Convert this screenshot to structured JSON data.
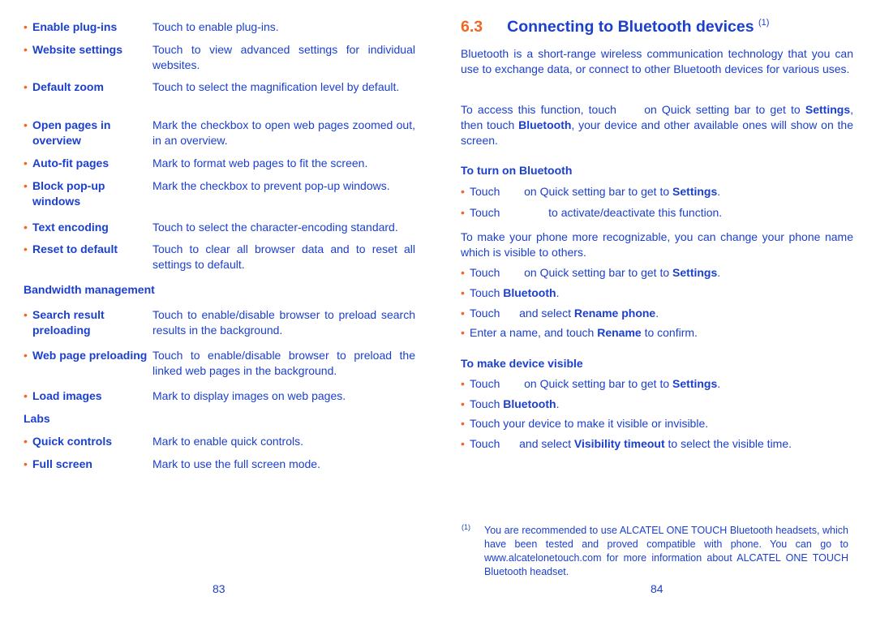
{
  "left": {
    "items": [
      {
        "label": "Enable plug-ins",
        "desc": "Touch to enable plug-ins."
      },
      {
        "label": "Website settings",
        "desc": "Touch to view advanced settings for individual websites."
      },
      {
        "label": "Default zoom",
        "desc": "Touch to select the magnification level by default."
      },
      {
        "label": "Open pages in overview",
        "desc": "Mark the checkbox to open web pages zoomed out, in an overview."
      },
      {
        "label": "Auto-fit pages",
        "desc": "Mark to format web pages to fit the screen."
      },
      {
        "label": "Block pop-up windows",
        "desc": "Mark the checkbox to prevent pop-up windows."
      },
      {
        "label": "Text encoding",
        "desc": "Touch to select the character-encoding standard."
      },
      {
        "label": "Reset to default",
        "desc": "Touch to clear all browser data and to reset all settings to default."
      },
      {
        "label": "Search result preloading",
        "desc": "Touch to enable/disable browser to preload search results in the background."
      },
      {
        "label": "Web page preloading",
        "desc": "Touch to enable/disable browser to preload the linked web pages in the background."
      },
      {
        "label": "Load images",
        "desc": "Mark to display images on web pages."
      },
      {
        "label": "Quick controls",
        "desc": "Mark to enable quick controls."
      },
      {
        "label": "Full screen",
        "desc": "Mark to use the full screen mode."
      }
    ],
    "headings": [
      "Bandwidth management",
      "Labs"
    ],
    "page_number": "83"
  },
  "right": {
    "section_number": "6.3",
    "title": "Connecting to Bluetooth devices",
    "title_note": "(1)",
    "blocks": [
      {
        "type": "para",
        "parts": [
          {
            "t": "Bluetooth is a short-range wireless communication technology that you can use to exchange data, or connect to other Bluetooth devices for various uses."
          }
        ]
      },
      {
        "type": "para",
        "parts": [
          {
            "t": "To access this function, touch "
          },
          {
            "gap": 1
          },
          {
            "t": " on Quick setting bar to get to "
          },
          {
            "t": "Settings",
            "b": true
          },
          {
            "t": ", then touch "
          },
          {
            "t": "Bluetooth",
            "b": true
          },
          {
            "t": ", your device and other available ones will show on the screen."
          }
        ]
      },
      {
        "type": "sub",
        "parts": [
          {
            "t": "To turn on Bluetooth"
          }
        ]
      },
      {
        "type": "bullet",
        "parts": [
          {
            "t": "Touch "
          },
          {
            "gap": 1
          },
          {
            "t": " on Quick setting bar to get to "
          },
          {
            "t": "Settings",
            "b": true
          },
          {
            "t": "."
          }
        ]
      },
      {
        "type": "bullet",
        "parts": [
          {
            "t": "Touch "
          },
          {
            "gap": 2
          },
          {
            "t": " to activate/deactivate this function."
          }
        ]
      },
      {
        "type": "para",
        "parts": [
          {
            "t": "To make your phone more recognizable, you can change your phone name which is visible to others."
          }
        ]
      },
      {
        "type": "bullet",
        "parts": [
          {
            "t": "Touch "
          },
          {
            "gap": 1
          },
          {
            "t": " on Quick setting bar to get to "
          },
          {
            "t": "Settings",
            "b": true
          },
          {
            "t": "."
          }
        ]
      },
      {
        "type": "bullet",
        "parts": [
          {
            "t": "Touch "
          },
          {
            "t": "Bluetooth",
            "b": true
          },
          {
            "t": "."
          }
        ]
      },
      {
        "type": "bullet",
        "parts": [
          {
            "t": "Touch "
          },
          {
            "gap": 0
          },
          {
            "t": " and select "
          },
          {
            "t": "Rename phone",
            "b": true
          },
          {
            "t": "."
          }
        ]
      },
      {
        "type": "bullet",
        "parts": [
          {
            "t": "Enter a name, and touch "
          },
          {
            "t": "Rename",
            "b": true
          },
          {
            "t": " to confirm."
          }
        ]
      },
      {
        "type": "sub",
        "parts": [
          {
            "t": "To make device visible"
          }
        ]
      },
      {
        "type": "bullet",
        "parts": [
          {
            "t": "Touch "
          },
          {
            "gap": 1
          },
          {
            "t": " on Quick setting bar to get to "
          },
          {
            "t": "Settings",
            "b": true
          },
          {
            "t": "."
          }
        ]
      },
      {
        "type": "bullet",
        "parts": [
          {
            "t": "Touch "
          },
          {
            "t": "Bluetooth",
            "b": true
          },
          {
            "t": "."
          }
        ]
      },
      {
        "type": "bullet",
        "parts": [
          {
            "t": "Touch your device to make it visible or invisible."
          }
        ]
      },
      {
        "type": "bullet",
        "parts": [
          {
            "t": "Touch "
          },
          {
            "gap": 0
          },
          {
            "t": " and select "
          },
          {
            "t": "Visibility timeout",
            "b": true
          },
          {
            "t": " to select the visible time."
          }
        ]
      }
    ],
    "footnote_marker": "(1)",
    "footnote": "You are recommended to use ALCATEL ONE TOUCH Bluetooth headsets, which have been tested and proved compatible with phone. You can go to www.alcatelonetouch.com for more information about ALCATEL ONE TOUCH Bluetooth headset.",
    "page_number": "84"
  },
  "colors": {
    "text": "#1b3fcf",
    "accent": "#f26522"
  },
  "bullet_glyph": "•"
}
